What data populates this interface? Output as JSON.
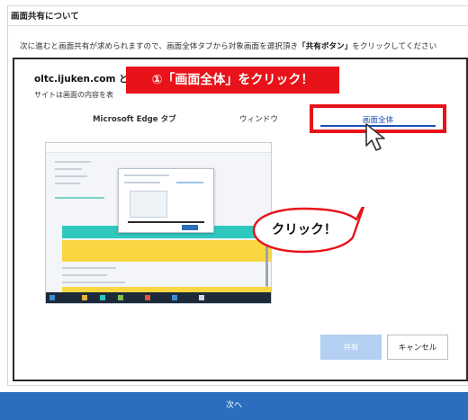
{
  "page": {
    "title": "画面共有について",
    "instruction_pre": "次に進むと画面共有が求められますので、画面全体タブから対象画面を選択頂き",
    "instruction_emph": "「共有ボタン」",
    "instruction_post": "をクリックしてください"
  },
  "dialog": {
    "site_name": "oltc.ijuken.com と",
    "site_desc": "サイトは画面の内容を表",
    "tabs": [
      {
        "label": "Microsoft Edge タブ",
        "selected": false
      },
      {
        "label": "ウィンドウ",
        "selected": false
      },
      {
        "label": "画面全体",
        "selected": true
      }
    ],
    "buttons": {
      "share": "共有",
      "cancel": "キャンセル"
    }
  },
  "annotations": {
    "step_callout": "①「画面全体」をクリック！",
    "click_bubble": "クリック！",
    "callout_color": "#e8131a"
  },
  "footer": {
    "next_label": "次へ"
  },
  "colors": {
    "accent": "#2a6ebd",
    "highlight": "#e8131a",
    "share_disabled": "#b3d0f2"
  }
}
